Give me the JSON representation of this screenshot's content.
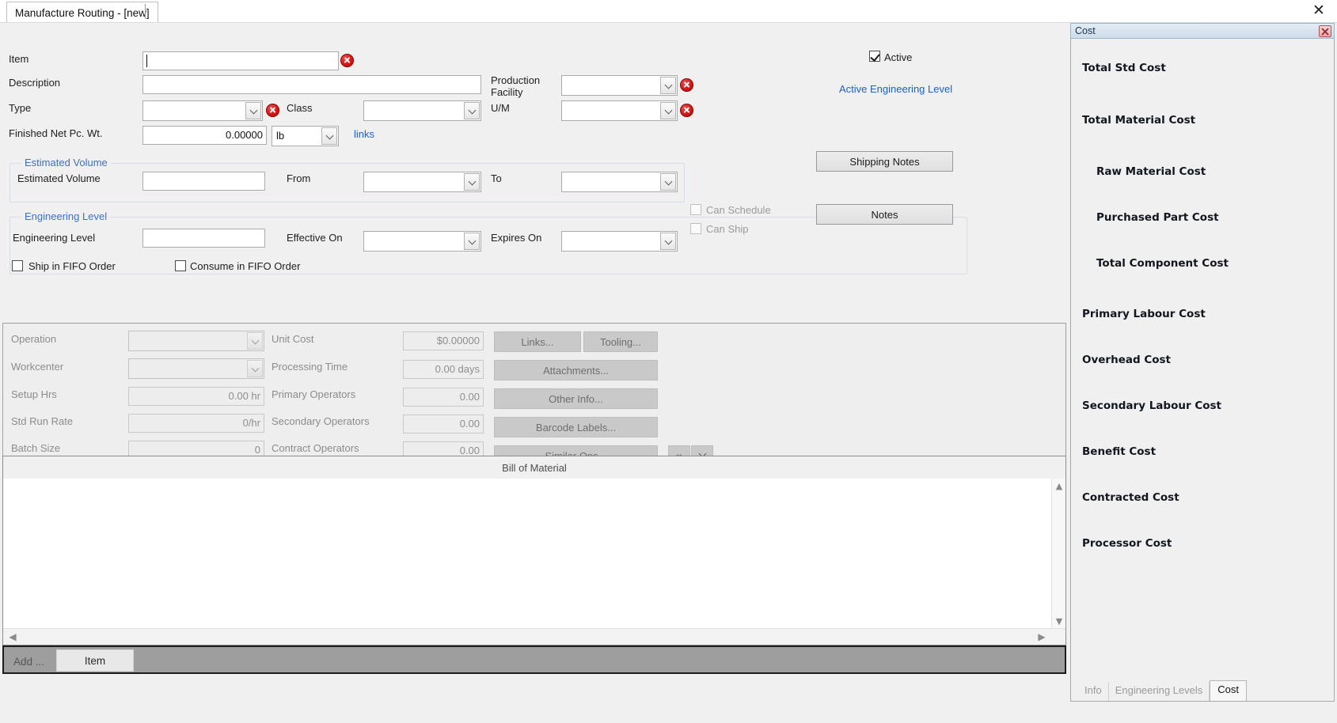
{
  "window": {
    "tab_label": "Manufacture Routing - [new]",
    "close_icon": "close-icon"
  },
  "form": {
    "item": {
      "label": "Item",
      "value": "",
      "required": true
    },
    "description": {
      "label": "Description",
      "value": ""
    },
    "type": {
      "label": "Type",
      "value": "",
      "required": true
    },
    "class": {
      "label": "Class",
      "value": ""
    },
    "finished_net_pc_wt": {
      "label": "Finished Net Pc. Wt.",
      "value": "0.00000"
    },
    "uom_unit": {
      "label": "lb"
    },
    "links": {
      "label": "links"
    },
    "production_facility": {
      "label": "Production Facility",
      "label_line1": "Production",
      "label_line2": "Facility",
      "value": "",
      "required": true
    },
    "um": {
      "label": "U/M",
      "value": "",
      "required": true
    },
    "active": {
      "label": "Active",
      "checked": true
    },
    "active_engineering_level": {
      "label": "Active Engineering Level"
    },
    "shipping_notes": {
      "label": "Shipping Notes"
    }
  },
  "estimated_volume_group": {
    "title": "Estimated Volume",
    "volume": {
      "label": "Estimated Volume",
      "value": ""
    },
    "from": {
      "label": "From",
      "value": ""
    },
    "to": {
      "label": "To",
      "value": ""
    }
  },
  "engineering_level_group": {
    "title": "Engineering Level",
    "level": {
      "label": "Engineering Level",
      "value": ""
    },
    "effective_on": {
      "label": "Effective On",
      "value": ""
    },
    "expires_on": {
      "label": "Expires On",
      "value": ""
    },
    "can_schedule": {
      "label": "Can Schedule",
      "checked": false,
      "disabled": true
    },
    "can_ship": {
      "label": "Can Ship",
      "checked": false,
      "disabled": true
    },
    "notes": {
      "label": "Notes"
    }
  },
  "fifo": {
    "ship": {
      "label": "Ship in FIFO Order",
      "checked": false
    },
    "consume": {
      "label": "Consume in FIFO Order",
      "checked": false
    }
  },
  "operations": {
    "operation": {
      "label": "Operation",
      "value": ""
    },
    "workcenter": {
      "label": "Workcenter",
      "value": ""
    },
    "setup_hrs": {
      "label": "Setup Hrs",
      "value": "0.00 hr"
    },
    "std_run_rate": {
      "label": "Std Run Rate",
      "value": "0/hr"
    },
    "batch_size": {
      "label": "Batch Size",
      "value": "0"
    },
    "unit_cost": {
      "label": "Unit Cost",
      "value": "$0.00000"
    },
    "processing_time": {
      "label": "Processing Time",
      "value": "0.00 days"
    },
    "primary_operators": {
      "label": "Primary Operators",
      "value": "0.00"
    },
    "secondary_operators": {
      "label": "Secondary Operators",
      "value": "0.00"
    },
    "contract_operators": {
      "label": "Contract Operators",
      "value": "0.00"
    },
    "buttons": {
      "links": "Links...",
      "tooling": "Tooling...",
      "attachments": "Attachments...",
      "other_info": "Other Info...",
      "barcode_labels": "Barcode Labels...",
      "similar_ops": "Similar Ops..."
    }
  },
  "bill_of_material": {
    "title": "Bill of Material",
    "scroll_up_icon": "chevron-up-icon",
    "scroll_down_icon": "chevron-down-icon",
    "scroll_left_icon": "chevron-left-icon",
    "scroll_right_icon": "chevron-right-icon"
  },
  "footer": {
    "add_label": "Add ...",
    "item_button": "Item"
  },
  "cost_panel": {
    "title": "Cost",
    "close_icon": "close-icon",
    "rows": [
      {
        "label": "Total Std Cost",
        "indent": 0
      },
      {
        "label": "Total Material Cost",
        "indent": 0
      },
      {
        "label": "Raw Material Cost",
        "indent": 1
      },
      {
        "label": "Purchased Part Cost",
        "indent": 1
      },
      {
        "label": "Total Component Cost",
        "indent": 1
      },
      {
        "label": "Primary Labour Cost",
        "indent": 0
      },
      {
        "label": "Overhead Cost",
        "indent": 0
      },
      {
        "label": "Secondary Labour Cost",
        "indent": 0
      },
      {
        "label": "Benefit Cost",
        "indent": 0
      },
      {
        "label": "Contracted Cost",
        "indent": 0
      },
      {
        "label": "Processor Cost",
        "indent": 0
      }
    ],
    "tabs": [
      {
        "label": "Info",
        "active": false
      },
      {
        "label": "Engineering Levels",
        "active": false
      },
      {
        "label": "Cost",
        "active": true
      }
    ]
  },
  "colors": {
    "accent_link": "#1c5fd0",
    "group_title": "#3d6fc4",
    "error_red": "#d51414",
    "panel_bg": "#f0f0f0"
  }
}
